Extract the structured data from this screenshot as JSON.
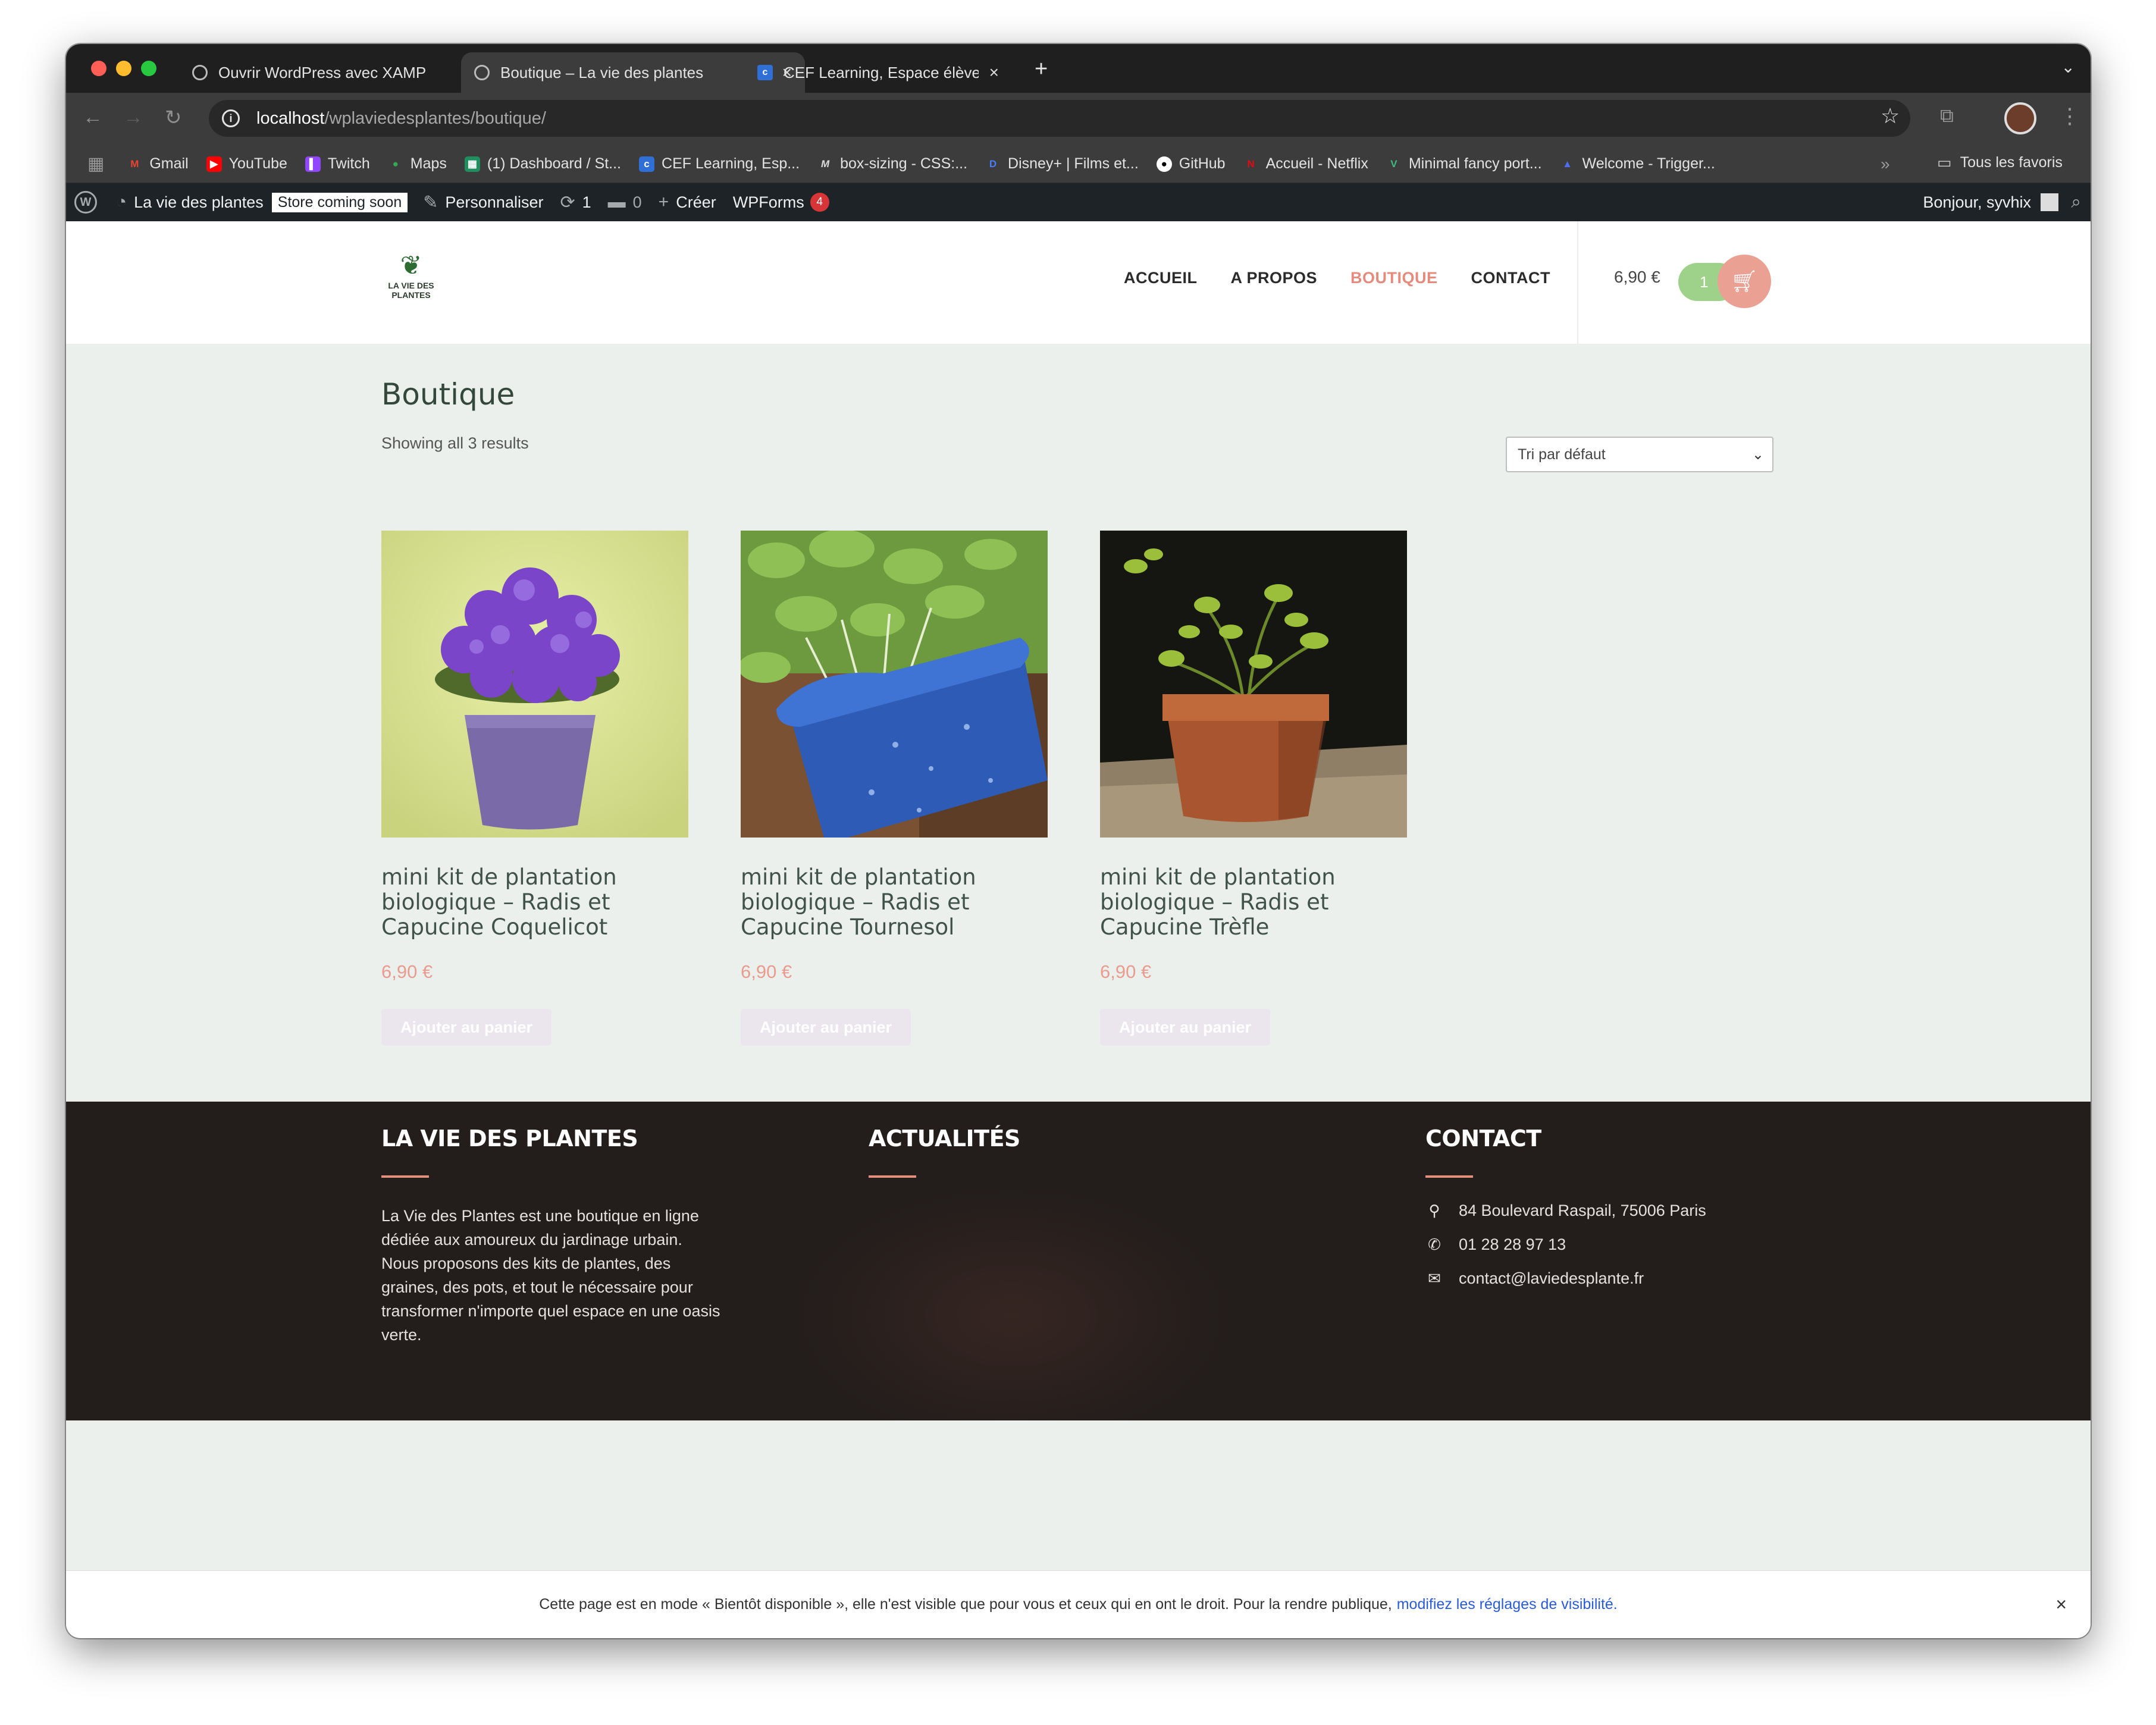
{
  "browser": {
    "tabs": [
      {
        "label": "Ouvrir WordPress avec XAMP",
        "active": false
      },
      {
        "label": "Boutique – La vie des plantes",
        "active": true
      },
      {
        "label": "CEF Learning, Espace élève d",
        "active": false
      }
    ],
    "new_tab": "+",
    "url_host": "localhost",
    "url_path": "/wplaviedesplantes/boutique/",
    "bookmarks": [
      {
        "label": "Gmail",
        "icon": "gmail-icon",
        "color": "#ea4335",
        "glyph": "M"
      },
      {
        "label": "YouTube",
        "icon": "youtube-icon",
        "color": "#ff0000",
        "glyph": "▶"
      },
      {
        "label": "Twitch",
        "icon": "twitch-icon",
        "color": "#9146ff",
        "glyph": "▌"
      },
      {
        "label": "Maps",
        "icon": "maps-icon",
        "color": "#34a853",
        "glyph": "●"
      },
      {
        "label": "(1) Dashboard / St...",
        "icon": "dashboard-icon",
        "color": "#1f8f5f",
        "glyph": "▦"
      },
      {
        "label": "CEF Learning, Esp...",
        "icon": "cef-icon",
        "color": "#2f6fd6",
        "glyph": "c"
      },
      {
        "label": "box-sizing - CSS:...",
        "icon": "mdn-icon",
        "color": "#3c3c3c",
        "glyph": "M"
      },
      {
        "label": "Disney+ | Films et...",
        "icon": "disney-icon",
        "color": "#113ccf",
        "glyph": "D"
      },
      {
        "label": "GitHub",
        "icon": "github-icon",
        "color": "#ffffff",
        "glyph": "●"
      },
      {
        "label": "Accueil - Netflix",
        "icon": "netflix-icon",
        "color": "#e50914",
        "glyph": "N"
      },
      {
        "label": "Minimal fancy port...",
        "icon": "vue-icon",
        "color": "#41b883",
        "glyph": "V"
      },
      {
        "label": "Welcome - Trigger...",
        "icon": "trigger-icon",
        "color": "#4f6ef7",
        "glyph": "▲"
      }
    ],
    "bookmarks_all": "Tous les favoris"
  },
  "adminbar": {
    "site_name": "La vie des plantes",
    "store_badge": "Store coming soon",
    "customize": "Personnaliser",
    "updates_count": "1",
    "comments_count": "0",
    "create": "Créer",
    "wpforms": "WPForms",
    "wpforms_count": "4",
    "greeting": "Bonjour, syvhix"
  },
  "site": {
    "logo_text_1": "LA VIE DES",
    "logo_text_2": "PLANTES",
    "nav": [
      "ACCUEIL",
      "A PROPOS",
      "BOUTIQUE",
      "CONTACT"
    ],
    "current_nav": "BOUTIQUE",
    "cart_total": "6,90 €",
    "cart_count": "1",
    "accent_color": "#e58b7e"
  },
  "shop": {
    "title": "Boutique",
    "result_count": "Showing all 3 results",
    "orderby": "Tri par défaut",
    "products": [
      {
        "name": "mini kit de plantation biologique – Radis et Capucine Coquelicot",
        "price": "6,90 €",
        "button": "Ajouter au panier"
      },
      {
        "name": "mini kit de plantation biologique – Radis et Capucine Tournesol",
        "price": "6,90 €",
        "button": "Ajouter au panier"
      },
      {
        "name": "mini kit de plantation biologique – Radis et Capucine Trèfle",
        "price": "6,90 €",
        "button": "Ajouter au panier"
      }
    ]
  },
  "footer": {
    "about_title": "LA VIE DES PLANTES",
    "about_text": "La Vie des Plantes est une boutique en ligne dédiée aux amoureux du jardinage urbain. Nous proposons des kits de plantes, des graines, des pots, et tout le nécessaire pour transformer n'importe quel espace en une oasis verte.",
    "news_title": "ACTUALITÉS",
    "contact_title": "CONTACT",
    "address": "84 Boulevard Raspail, 75006 Paris",
    "phone": "01 28 28 97 13",
    "email": "contact@laviedesplante.fr"
  },
  "notice": {
    "text": "Cette page est en mode « Bientôt disponible », elle n'est visible que pour vous et ceux qui en ont le droit. Pour la rendre publique,",
    "link": "modifiez les réglages de visibilité.",
    "close": "×"
  }
}
